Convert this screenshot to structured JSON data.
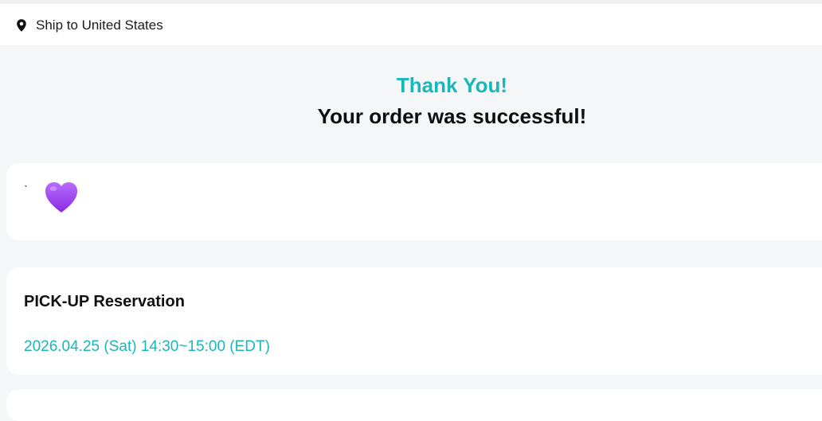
{
  "header": {
    "ship_to": "Ship to United States",
    "location_icon": "map-pin-icon"
  },
  "confirmation": {
    "thanks": "Thank You!",
    "message": "Your order was successful!",
    "accent_color": "#18b7b9"
  },
  "note_card": {
    "mark": "ˋ",
    "emoji_icon": "purple-heart-icon"
  },
  "pickup": {
    "title": "PICK-UP Reservation",
    "time": "2026.04.25 (Sat) 14:30~15:00 (EDT)"
  }
}
